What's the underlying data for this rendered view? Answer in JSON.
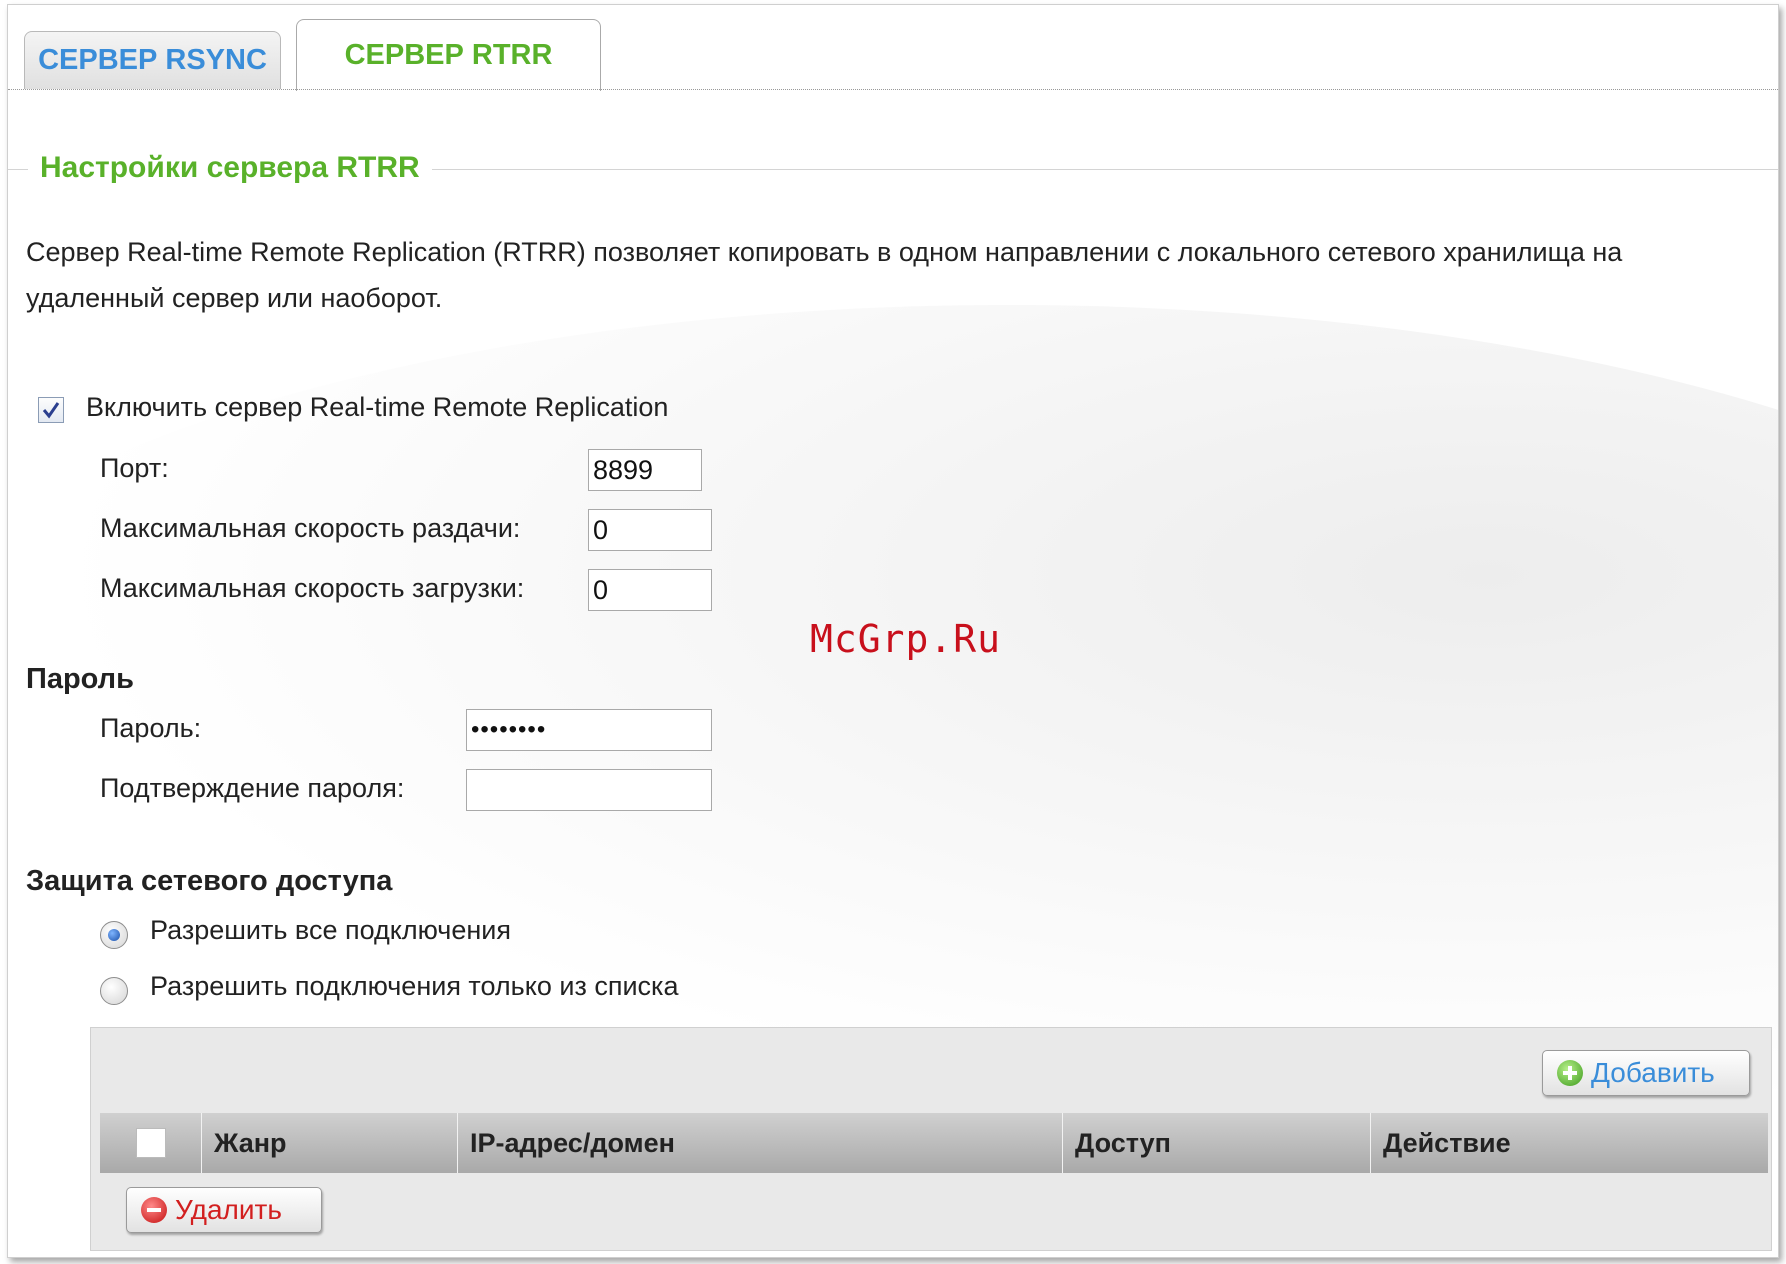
{
  "tabs": [
    {
      "label": "СЕРВЕР RSYNC",
      "active": false
    },
    {
      "label": "СЕРВЕР RTRR",
      "active": true
    }
  ],
  "section": {
    "title": "Настройки сервера RTRR",
    "description": "Сервер Real-time Remote Replication (RTRR) позволяет копировать в одном направлении с локального сетевого хранилища на удаленный сервер или наоборот."
  },
  "enable": {
    "label": "Включить сервер Real-time Remote Replication",
    "checked": true
  },
  "fields": {
    "port": {
      "label": "Порт:",
      "value": "8899"
    },
    "upload_speed": {
      "label": "Максимальная скорость раздачи:",
      "value": "0"
    },
    "download_speed": {
      "label": "Максимальная скорость загрузки:",
      "value": "0"
    }
  },
  "password": {
    "heading": "Пароль",
    "password_label": "Пароль:",
    "password_value": "••••••••",
    "confirm_label": "Подтверждение пароля:",
    "confirm_value": ""
  },
  "network": {
    "heading": "Защита сетевого доступа",
    "option_all": "Разрешить все подключения",
    "option_list": "Разрешить подключения только из списка",
    "selected": "all"
  },
  "table": {
    "add_button": "Добавить",
    "delete_button": "Удалить",
    "columns": [
      "Жанр",
      "IP-адрес/домен",
      "Доступ",
      "Действие"
    ]
  },
  "watermark": "McGrp.Ru",
  "colors": {
    "tab_inactive": "#3a8dd9",
    "accent_green": "#59b12a",
    "delete_red": "#d21f1f"
  }
}
